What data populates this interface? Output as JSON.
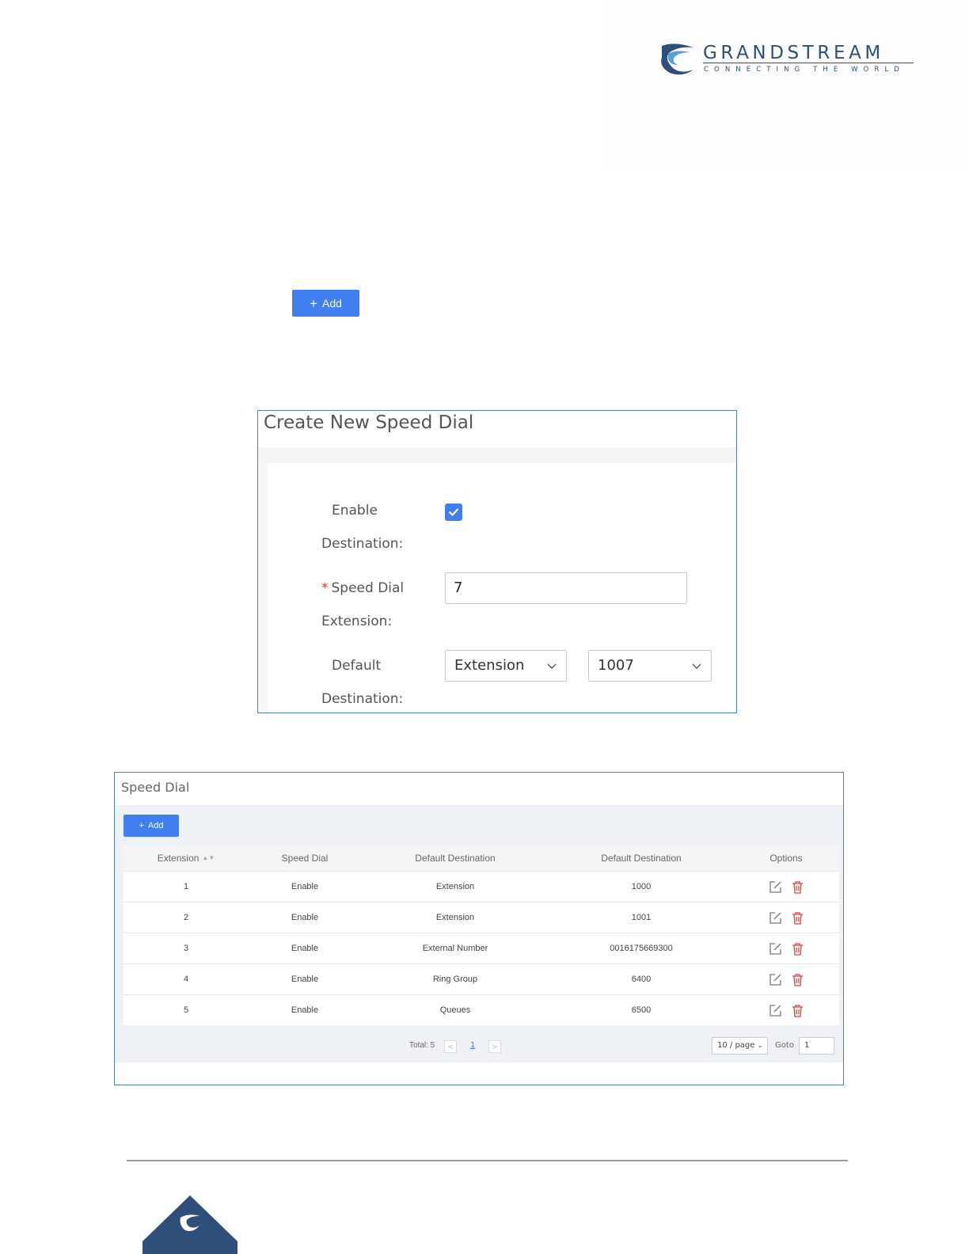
{
  "header": {
    "brand": "GRANDSTREAM",
    "tagline": "CONNECTING THE WORLD"
  },
  "add_button": {
    "label": "Add"
  },
  "dialog": {
    "title": "Create New Speed Dial",
    "enable_label_1": "Enable",
    "enable_label_2": "Destination:",
    "enable_checked": true,
    "speed_dial_label_1": "Speed Dial",
    "speed_dial_label_2": "Extension:",
    "required_mark": "*",
    "speed_dial_value": "7",
    "default_label_1": "Default",
    "default_label_2": "Destination:",
    "destination_type": "Extension",
    "destination_value": "1007"
  },
  "panel": {
    "title": "Speed Dial",
    "add_label": "Add",
    "columns": [
      "Extension",
      "Speed Dial",
      "Default Destination",
      "Default Destination",
      "Options"
    ],
    "rows": [
      [
        "1",
        "Enable",
        "Extension",
        "1000"
      ],
      [
        "2",
        "Enable",
        "Extension",
        "1001"
      ],
      [
        "3",
        "Enable",
        "External Number",
        "0016175669300"
      ],
      [
        "4",
        "Enable",
        "Ring Group",
        "6400"
      ],
      [
        "5",
        "Enable",
        "Queues",
        "6500"
      ]
    ],
    "pagination": {
      "total": "Total: 5",
      "prev": "<",
      "page": "1",
      "next": ">",
      "page_size": "10 / page",
      "goto_label": "Goto",
      "goto_value": "1"
    }
  },
  "colors": {
    "accent": "#3f7ff0",
    "brand": "#2e4f79",
    "danger": "#e63a3a"
  }
}
